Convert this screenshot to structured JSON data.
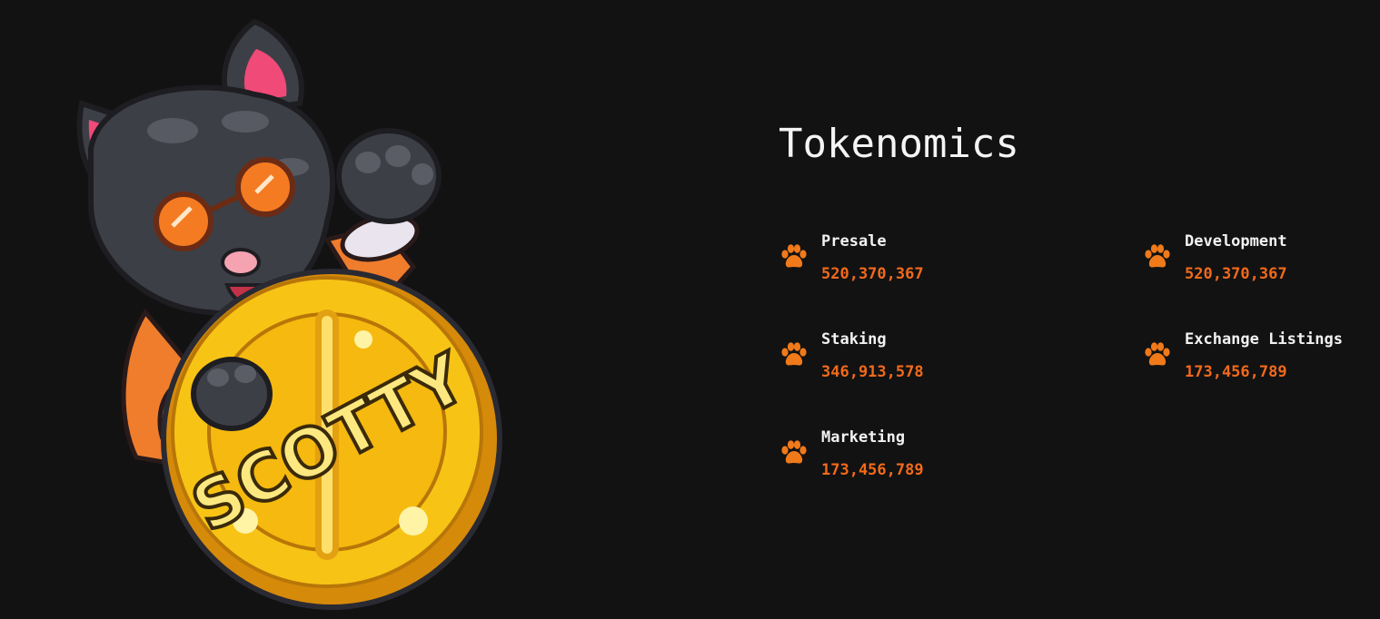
{
  "section": {
    "title": "Tokenomics"
  },
  "mascot": {
    "coin_text": "SCOTTY",
    "icon": "scotty-dog-coin-illustration"
  },
  "colors": {
    "background": "#121212",
    "accent": "#f26a1b",
    "paw": "#f07a1a",
    "text": "#f2f2f2"
  },
  "allocations": [
    {
      "label": "Presale",
      "amount": "520,370,367",
      "icon": "paw-icon"
    },
    {
      "label": "Development",
      "amount": "520,370,367",
      "icon": "paw-icon"
    },
    {
      "label": "Staking",
      "amount": "346,913,578",
      "icon": "paw-icon"
    },
    {
      "label": "Exchange Listings",
      "amount": "173,456,789",
      "icon": "paw-icon"
    },
    {
      "label": "Marketing",
      "amount": "173,456,789",
      "icon": "paw-icon"
    }
  ]
}
